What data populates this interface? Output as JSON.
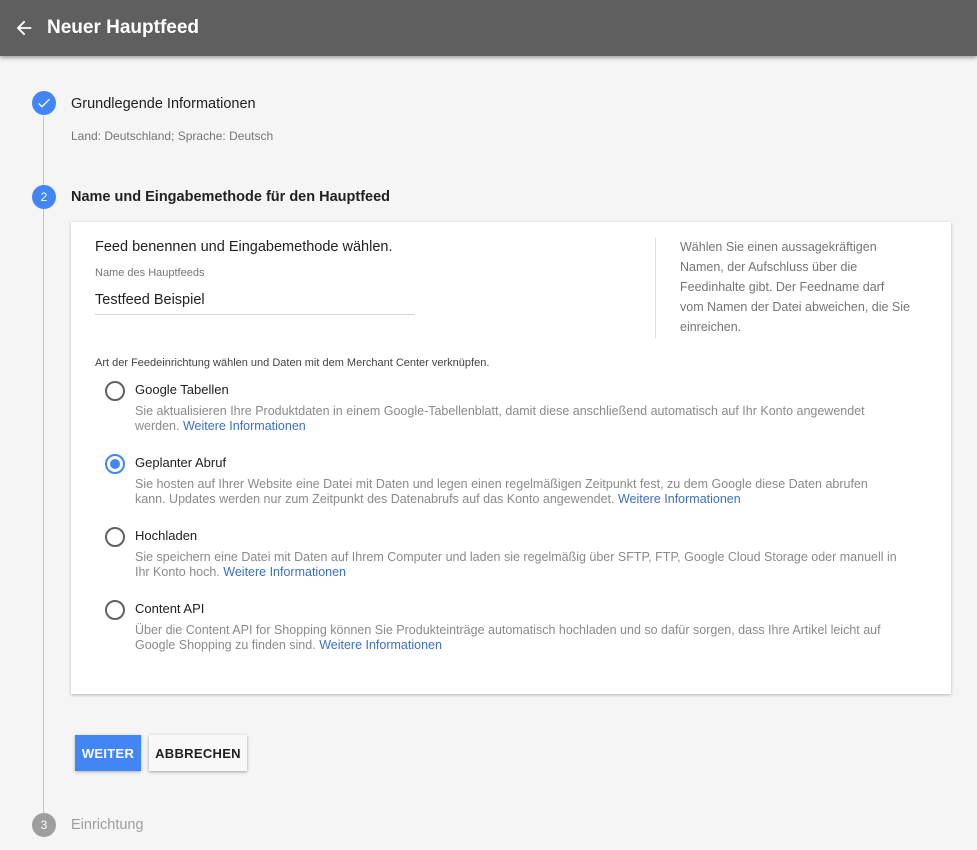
{
  "header": {
    "title": "Neuer Hauptfeed",
    "back_icon": "arrow-left-icon",
    "background": "#5f5f5f"
  },
  "steps": [
    {
      "number": "1",
      "status": "completed",
      "title": "Grundlegende Informationen",
      "subtitle": "Land: Deutschland; Sprache: Deutsch",
      "icon": "check-icon"
    },
    {
      "number": "2",
      "status": "active",
      "title": "Name und Eingabemethode für den Hauptfeed"
    },
    {
      "number": "3",
      "status": "pending",
      "title": "Einrichtung"
    }
  ],
  "form": {
    "heading": "Feed benennen und Eingabemethode wählen.",
    "name_label": "Name des Hauptfeeds",
    "name_value": "Testfeed Beispiel",
    "help_text": "Wählen Sie einen aussagekräftigen Namen, der Aufschluss über die Feedinhalte gibt. Der Feedname darf vom Namen der Datei abweichen, die Sie einreichen.",
    "method_label": "Art der Feedeinrichtung wählen und Daten mit dem Merchant Center verknüpfen.",
    "options": [
      {
        "title": "Google Tabellen",
        "selected": false,
        "description": "Sie aktualisieren Ihre Produktdaten in einem Google-Tabellenblatt, damit diese anschließend automatisch auf Ihr Konto angewendet werden.",
        "link": "Weitere Informationen"
      },
      {
        "title": "Geplanter Abruf",
        "selected": true,
        "description": "Sie hosten auf Ihrer Website eine Datei mit Daten und legen einen regelmäßigen Zeitpunkt fest, zu dem Google diese Daten abrufen kann. Updates werden nur zum Zeitpunkt des Datenabrufs auf das Konto angewendet.",
        "link": "Weitere Informationen"
      },
      {
        "title": "Hochladen",
        "selected": false,
        "description": "Sie speichern eine Datei mit Daten auf Ihrem Computer und laden sie regelmäßig über SFTP, FTP, Google Cloud Storage oder manuell in Ihr Konto hoch.",
        "link": "Weitere Informationen"
      },
      {
        "title": "Content API",
        "selected": false,
        "description": "Über die Content API for Shopping können Sie Produkteinträge automatisch hochladen und so dafür sorgen, dass Ihre Artikel leicht auf Google Shopping zu finden sind.",
        "link": "Weitere Informationen"
      }
    ]
  },
  "actions": {
    "continue_label": "WEITER",
    "cancel_label": "ABBRECHEN"
  },
  "colors": {
    "accent": "#4285f4",
    "link": "#3b6fc6",
    "pending_step": "#9e9e9e"
  }
}
